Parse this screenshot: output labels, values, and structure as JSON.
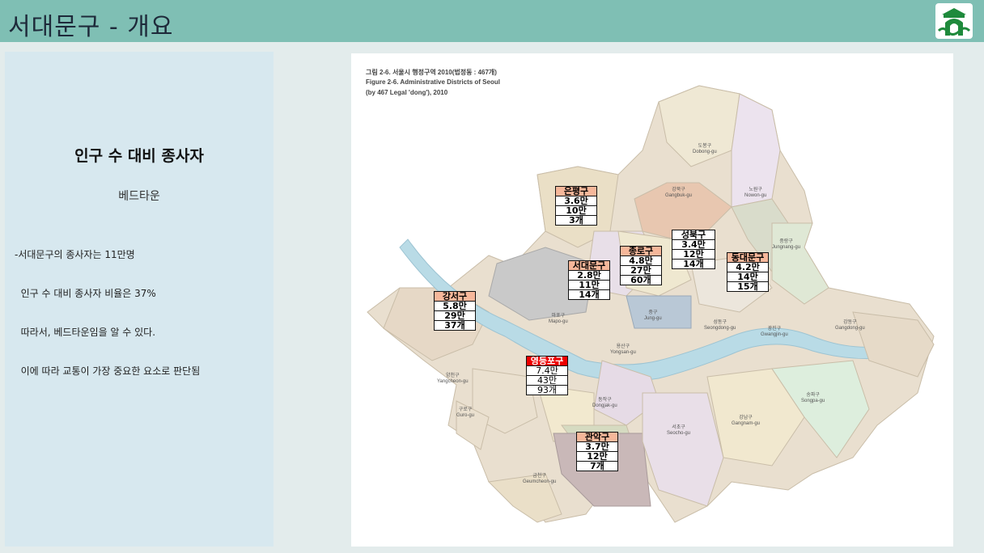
{
  "header": {
    "title": "서대문구 - 개요"
  },
  "left": {
    "heading": "인구 수 대비 종사자",
    "subheading": "베드타운",
    "lines": [
      "-서대문구의 종사자는 11만명",
      "  인구 수 대비 종사자 비율은 37%",
      "  따라서, 베드타운임을 알 수 있다.",
      "  이에 따라 교통이 가장 중요한 요소로 판단됨"
    ]
  },
  "map": {
    "caption": [
      "그림 2-6. 서울시 행정구역 2010(법정동 : 467개)",
      "Figure 2-6. Administrative Districts of Seoul",
      "(by 467 Legal 'dong'), 2010"
    ],
    "district_labels": [
      {
        "ko": "도봉구",
        "en": "Dobong-gu"
      },
      {
        "ko": "강북구",
        "en": "Gangbuk-gu"
      },
      {
        "ko": "노원구",
        "en": "Nowon-gu"
      },
      {
        "ko": "중랑구",
        "en": "Jungnang-gu"
      },
      {
        "ko": "마포구",
        "en": "Mapo-gu"
      },
      {
        "ko": "중구",
        "en": "Jung-gu"
      },
      {
        "ko": "용산구",
        "en": "Yongsan-gu"
      },
      {
        "ko": "성동구",
        "en": "Seongdong-gu"
      },
      {
        "ko": "광진구",
        "en": "Gwangjin-gu"
      },
      {
        "ko": "강동구",
        "en": "Gangdong-gu"
      },
      {
        "ko": "양천구",
        "en": "Yangcheon-gu"
      },
      {
        "ko": "구로구",
        "en": "Guro-gu"
      },
      {
        "ko": "동작구",
        "en": "Dongjak-gu"
      },
      {
        "ko": "서초구",
        "en": "Seocho-gu"
      },
      {
        "ko": "강남구",
        "en": "Gangnam-gu"
      },
      {
        "ko": "송파구",
        "en": "Songpa-gu"
      },
      {
        "ko": "금천구",
        "en": "Geumcheon-gu"
      }
    ],
    "info_boxes": [
      {
        "name": "은평구",
        "population": "3.6만",
        "workers": "10만",
        "count": "3개",
        "highlight": "normal"
      },
      {
        "name": "종로구",
        "population": "4.8만",
        "workers": "27만",
        "count": "60개",
        "highlight": "normal"
      },
      {
        "name": "성북구",
        "population": "3.4만",
        "workers": "12만",
        "count": "14개",
        "highlight": "none"
      },
      {
        "name": "서대문구",
        "population": "2.8만",
        "workers": "11만",
        "count": "14개",
        "highlight": "normal"
      },
      {
        "name": "동대문구",
        "population": "4.2만",
        "workers": "14만",
        "count": "15개",
        "highlight": "normal"
      },
      {
        "name": "강서구",
        "population": "5.8만",
        "workers": "29만",
        "count": "37개",
        "highlight": "normal"
      },
      {
        "name": "영등포구",
        "population": "7.4만",
        "workers": "43만",
        "count": "93개",
        "highlight": "red"
      },
      {
        "name": "관악구",
        "population": "3.7만",
        "workers": "12만",
        "count": "7개",
        "highlight": "normal"
      }
    ]
  },
  "colors": {
    "header": "#7fbfb4",
    "panel": "#d7e8ef",
    "river": "#b9dbe6",
    "highlight": "#f6b79a",
    "alert": "#ee0000"
  }
}
